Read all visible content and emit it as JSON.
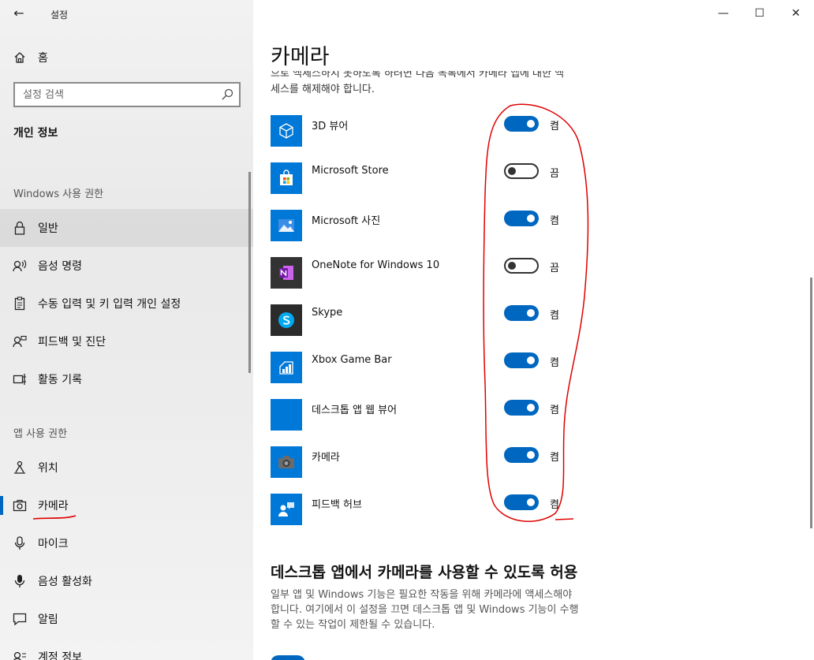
{
  "window": {
    "app_title": "설정",
    "back_glyph": "←",
    "minimize_glyph": "—",
    "maximize_glyph": "☐",
    "close_glyph": "✕"
  },
  "sidebar": {
    "home_label": "홈",
    "search_placeholder": "설정 검색",
    "section_title": "개인 정보",
    "group1_label": "Windows 사용 권한",
    "group1_items": [
      {
        "label": "일반",
        "icon": "lock-icon"
      },
      {
        "label": "음성 명령",
        "icon": "voice-icon"
      },
      {
        "label": "수동 입력 및 키 입력 개인 설정",
        "icon": "clipboard-icon"
      },
      {
        "label": "피드백 및 진단",
        "icon": "feedback-icon"
      },
      {
        "label": "활동 기록",
        "icon": "timeline-icon"
      }
    ],
    "group2_label": "앱 사용 권한",
    "group2_items": [
      {
        "label": "위치",
        "icon": "location-icon"
      },
      {
        "label": "카메라",
        "icon": "camera-icon"
      },
      {
        "label": "마이크",
        "icon": "microphone-icon"
      },
      {
        "label": "음성 활성화",
        "icon": "voice-activation-icon"
      },
      {
        "label": "알림",
        "icon": "notification-icon"
      },
      {
        "label": "계정 정보",
        "icon": "account-icon"
      }
    ]
  },
  "main": {
    "page_title": "카메라",
    "cut_line1": "으로 액세스하지 못하도록 하려면 다음 목록에서 카메라 앱에 대한 액",
    "cut_line2": "세스를 해제해야 합니다.",
    "apps": [
      {
        "name": "3D 뷰어",
        "state": "켬",
        "on": true,
        "icon": "cube-icon"
      },
      {
        "name": "Microsoft Store",
        "state": "끔",
        "on": false,
        "icon": "store-icon"
      },
      {
        "name": "Microsoft 사진",
        "state": "켬",
        "on": true,
        "icon": "photos-icon"
      },
      {
        "name": "OneNote for Windows 10",
        "state": "끔",
        "on": false,
        "icon": "onenote-icon"
      },
      {
        "name": "Skype",
        "state": "켬",
        "on": true,
        "icon": "skype-icon"
      },
      {
        "name": "Xbox Game Bar",
        "state": "켬",
        "on": true,
        "icon": "gamebar-icon"
      },
      {
        "name": "데스크톱 앱 웹 뷰어",
        "state": "켬",
        "on": true,
        "icon": "webviewer-icon"
      },
      {
        "name": "카메라",
        "state": "켬",
        "on": true,
        "icon": "camera-app-icon"
      },
      {
        "name": "피드백 허브",
        "state": "켬",
        "on": true,
        "icon": "feedback-hub-icon"
      }
    ],
    "section2_title": "데스크톱 앱에서 카메라를 사용할 수 있도록 허용",
    "desc_line1": "일부 앱 및 Windows 기능은 필요한 작동을 위해 카메라에 액세스해야",
    "desc_line2": "합니다. 여기에서 이 설정을 끄면 데스크톱 앱 및 Windows 기능이 수행",
    "desc_line3": "할 수 있는 작업이 제한될 수 있습니다."
  },
  "colors": {
    "accent": "#0067c0",
    "tile_blue": "#0078d7",
    "annotation_red": "#e00000"
  }
}
